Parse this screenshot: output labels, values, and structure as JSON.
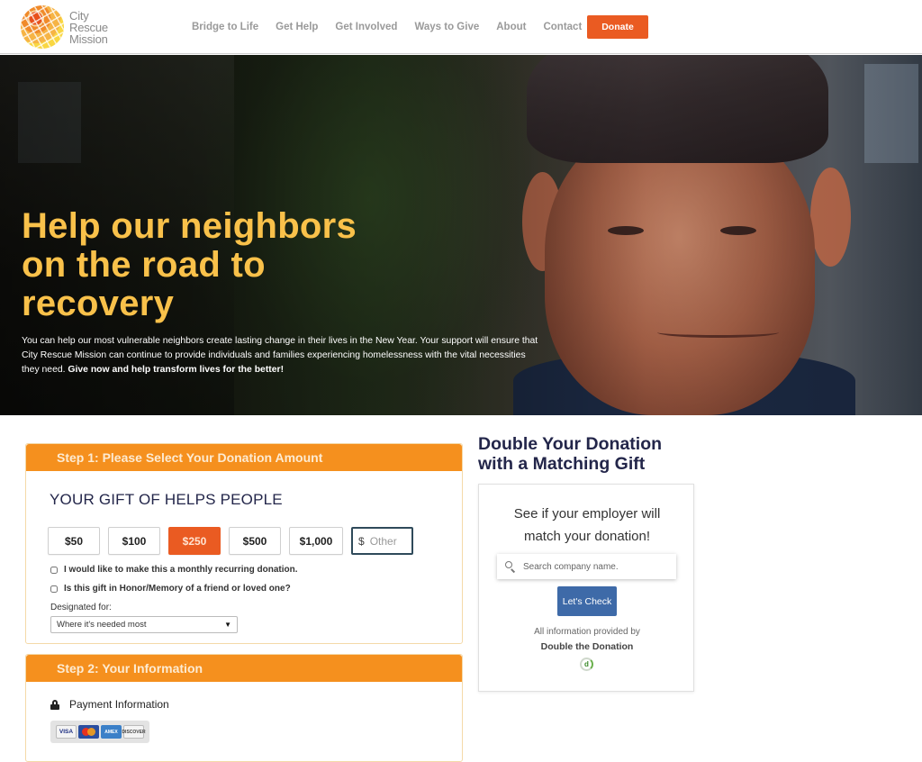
{
  "brand": {
    "logo_lines": [
      "City",
      "Rescue",
      "Mission"
    ],
    "accent_color": "#ea5b22",
    "hero_title_color": "#f9c14a",
    "step_header_color": "#f5901e",
    "navy_color": "#23264a"
  },
  "nav": {
    "items": [
      "Bridge to Life",
      "Get Help",
      "Get Involved",
      "Ways to Give",
      "About",
      "Contact"
    ],
    "donate_label": "Donate"
  },
  "hero": {
    "title": "Help our neighbors on the road to recovery",
    "body": "You can help our most vulnerable neighbors create lasting change in their lives in the New Year. Your support will ensure that City Rescue Mission can continue to provide individuals and families experiencing homelessness with the vital necessities they need.",
    "body_bold": "Give now and help transform lives for the better!"
  },
  "step1": {
    "header": "Step 1: Please Select Your Donation Amount",
    "gift_title": "YOUR GIFT OF HELPS PEOPLE",
    "amounts": [
      "$50",
      "$100",
      "$250",
      "$500",
      "$1,000"
    ],
    "selected_amount": "$250",
    "other_currency": "$",
    "other_placeholder": "Other",
    "monthly_label": "I would like to make this a monthly recurring donation.",
    "monthly_checked": false,
    "honor_label": "Is this gift in Honor/Memory of a friend or loved one?",
    "honor_checked": false,
    "designated_label": "Designated for:",
    "designated_value": "Where it's needed most"
  },
  "step2": {
    "header": "Step 2: Your Information",
    "payment_label": "Payment Information",
    "cards": [
      "VISA",
      "MasterCard",
      "American Express",
      "Discover"
    ]
  },
  "matching": {
    "title": "Double Your Donation with a Matching Gift",
    "lead": "See if your employer will match your donation!",
    "search_placeholder": "Search company name.",
    "check_label": "Let's Check",
    "provided_by": "All information provided by",
    "provider": "Double the Donation"
  }
}
